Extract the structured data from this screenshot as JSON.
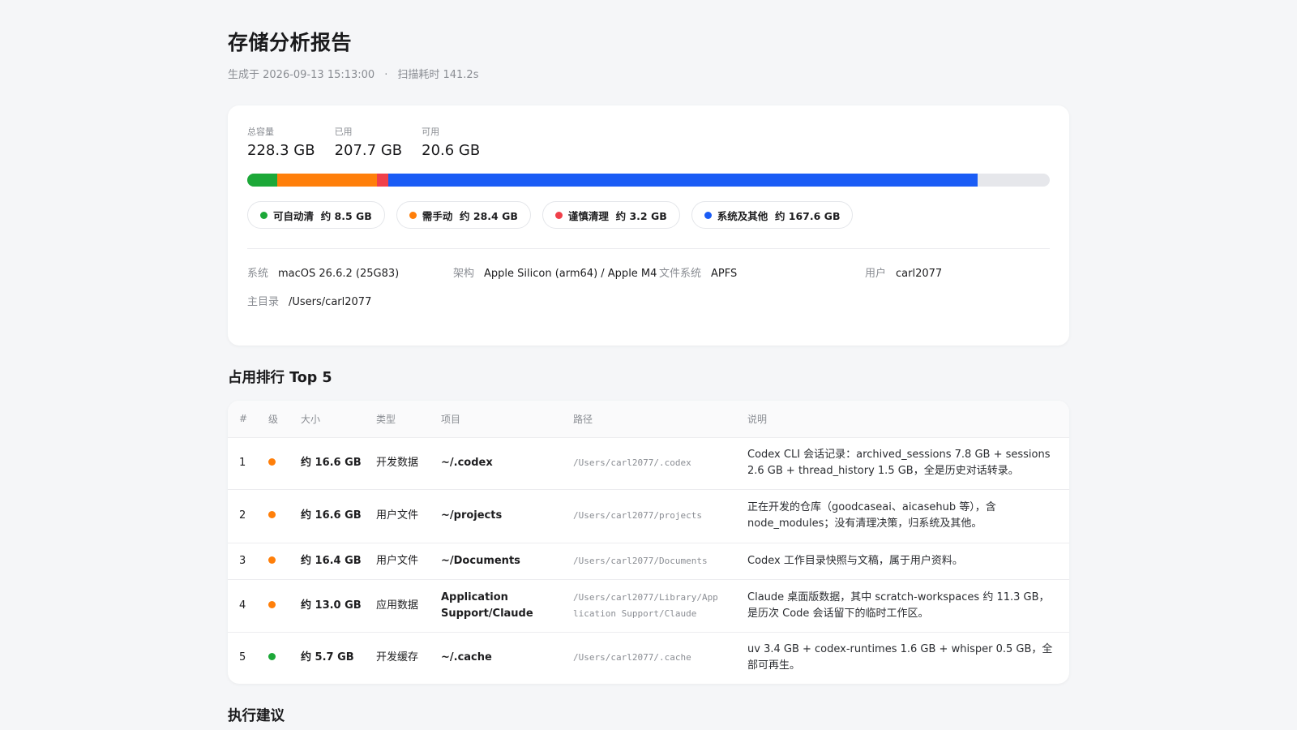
{
  "report": {
    "title": "存储分析报告",
    "generated_label": "生成于 2026-09-13 15:13:00",
    "separator": "·",
    "scan_label": "扫描耗时 141.2s"
  },
  "capacity": {
    "total": {
      "label": "总容量",
      "value": "228.3 GB"
    },
    "used": {
      "label": "已用",
      "value": "207.7 GB"
    },
    "free": {
      "label": "可用",
      "value": "20.6 GB"
    }
  },
  "usage": {
    "total_gb": 228.3,
    "segments": [
      {
        "name": "可自动清",
        "gb": 8.5,
        "color": "#1ca838"
      },
      {
        "name": "需手动",
        "gb": 28.4,
        "color": "#ff7f0a"
      },
      {
        "name": "谨慎清理",
        "gb": 3.2,
        "color": "#f0404a"
      },
      {
        "name": "系统及其他",
        "gb": 167.6,
        "color": "#1a5cf5"
      }
    ]
  },
  "chips": [
    {
      "label": "可自动清  约 8.5 GB",
      "color": "#1ca838"
    },
    {
      "label": "需手动  约 28.4 GB",
      "color": "#ff7f0a"
    },
    {
      "label": "谨慎清理  约 3.2 GB",
      "color": "#f0404a"
    },
    {
      "label": "系统及其他  约 167.6 GB",
      "color": "#1a5cf5"
    }
  ],
  "system": {
    "os": {
      "label": "系统",
      "value": "macOS 26.6.2 (25G83)"
    },
    "arch": {
      "label": "架构",
      "value": "Apple Silicon (arm64) / Apple M4"
    },
    "fs": {
      "label": "文件系统",
      "value": "APFS"
    },
    "user": {
      "label": "用户",
      "value": "carl2077"
    },
    "home": {
      "label": "主目录",
      "value": "/Users/carl2077"
    }
  },
  "top5": {
    "title": "占用排行 Top 5",
    "headers": {
      "rank": "#",
      "level": "级",
      "size": "大小",
      "type": "类型",
      "item": "项目",
      "path": "路径",
      "desc": "说明"
    },
    "rows": [
      {
        "rank": "1",
        "level_color": "#ff7f0a",
        "size": "约 16.6 GB",
        "type": "开发数据",
        "item": "~/.codex",
        "path": "/Users/carl2077/.codex",
        "desc": "Codex CLI 会话记录：archived_sessions 7.8 GB + sessions 2.6 GB + thread_history 1.5 GB，全是历史对话转录。"
      },
      {
        "rank": "2",
        "level_color": "#ff7f0a",
        "size": "约 16.6 GB",
        "type": "用户文件",
        "item": "~/projects",
        "path": "/Users/carl2077/projects",
        "desc": "正在开发的仓库（goodcaseai、aicasehub 等），含 node_modules；没有清理决策，归系统及其他。"
      },
      {
        "rank": "3",
        "level_color": "#ff7f0a",
        "size": "约 16.4 GB",
        "type": "用户文件",
        "item": "~/Documents",
        "path": "/Users/carl2077/Documents",
        "desc": "Codex 工作目录快照与文稿，属于用户资料。"
      },
      {
        "rank": "4",
        "level_color": "#ff7f0a",
        "size": "约 13.0 GB",
        "type": "应用数据",
        "item": "Application Support/Claude",
        "path": "/Users/carl2077/Library/Application Support/Claude",
        "desc": "Claude 桌面版数据，其中 scratch-workspaces 约 11.3 GB，是历次 Code 会话留下的临时工作区。"
      },
      {
        "rank": "5",
        "level_color": "#1ca838",
        "size": "约 5.7 GB",
        "type": "开发缓存",
        "item": "~/.cache",
        "path": "/Users/carl2077/.cache",
        "desc": "uv 3.4 GB + codex-runtimes 1.6 GB + whisper 0.5 GB，全部可再生。"
      }
    ]
  },
  "suggestions": {
    "title": "执行建议"
  }
}
